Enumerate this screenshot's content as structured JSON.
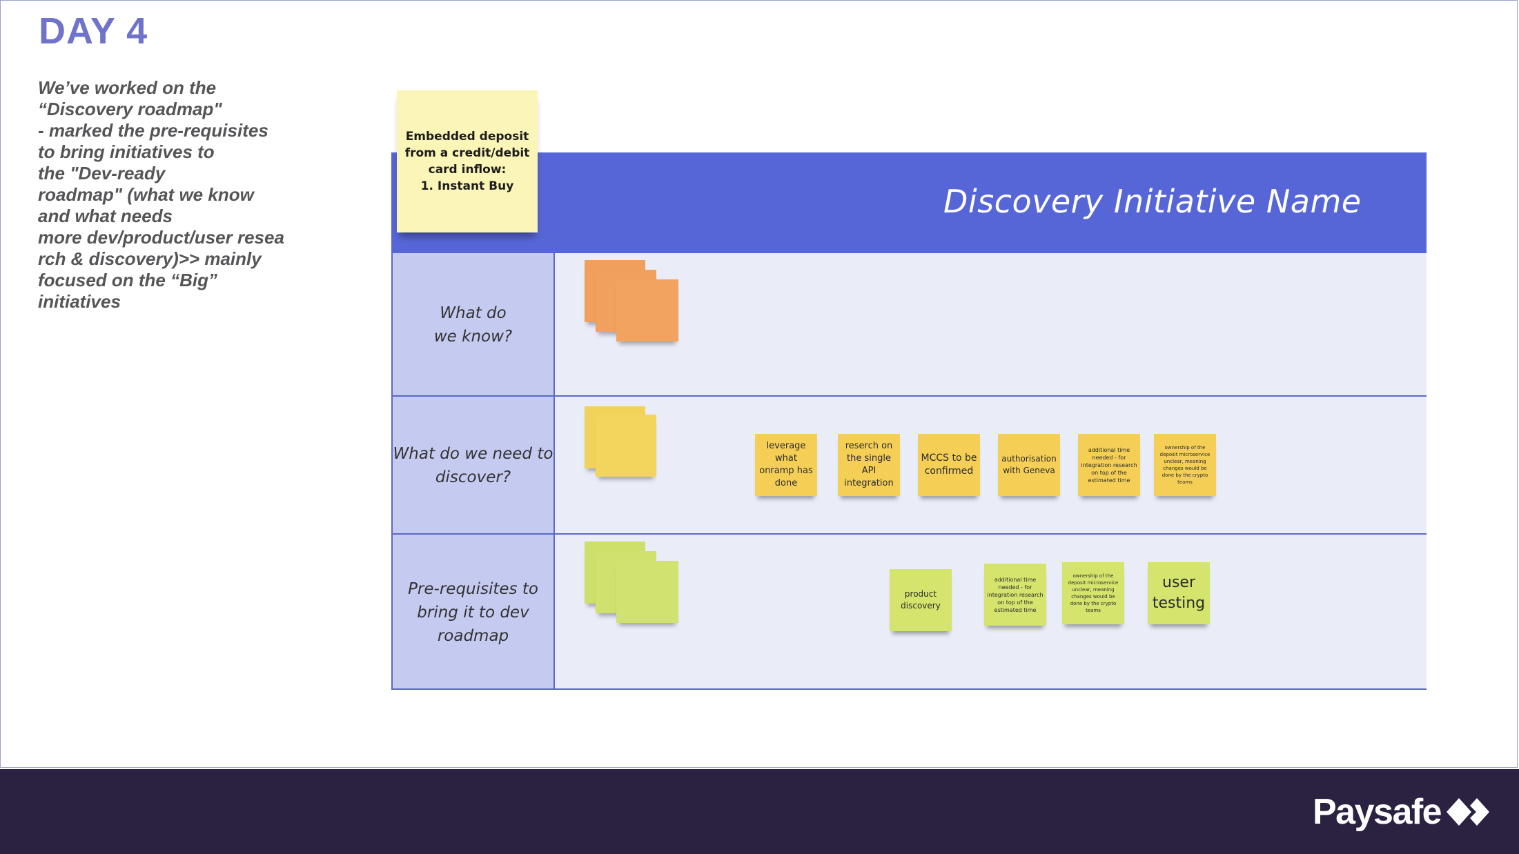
{
  "slide": {
    "title": "DAY 4",
    "description": "We’ve worked on the\n“Discovery roadmap\"\n- marked the pre-requisites\nto bring initiatives to\nthe \"Dev-ready\nroadmap\" (what we know\nand what needs\nmore dev/product/user resea\nrch & discovery)>> mainly\nfocused on the “Big”\ninitiatives"
  },
  "main_note": {
    "text": "Embedded deposit\nfrom a credit/debit\ncard inflow:\n1. Instant Buy",
    "color": "#fcf5b8"
  },
  "board": {
    "title": "Discovery Initiative Name",
    "header_color": "#5766d6",
    "rows": [
      {
        "label": "What do\nwe know?"
      },
      {
        "label": "What do we need to\ndiscover?"
      },
      {
        "label": "Pre-requisites to\nbring it to dev\nroadmap"
      }
    ]
  },
  "stickies_discover": [
    {
      "text": "leverage what onramp has done"
    },
    {
      "text": "reserch on the single API integration"
    },
    {
      "text": "MCCS to be confirmed"
    },
    {
      "text": "authorisation with Geneva"
    },
    {
      "text": "additional time needed - for integration research on top of the estimated time"
    },
    {
      "text": "ownership of the deposit microservice unclear, meaning changes would be done by the crypto teams"
    }
  ],
  "stickies_prereq": [
    {
      "text": "product discovery"
    },
    {
      "text": "additional time needed - for integration research on top of the estimated time"
    },
    {
      "text": "ownership of the deposit microservice unclear, meaning changes would be done by the crypto teams"
    },
    {
      "text": "user testing"
    }
  ],
  "colors": {
    "orange_sticky": "#f0a05c",
    "yellow_sticky": "#f2d35a",
    "green_sticky": "#cfe06a"
  },
  "footer": {
    "logo_text": "Paysafe",
    "logo_icon": "paysafe-diamonds-icon"
  }
}
